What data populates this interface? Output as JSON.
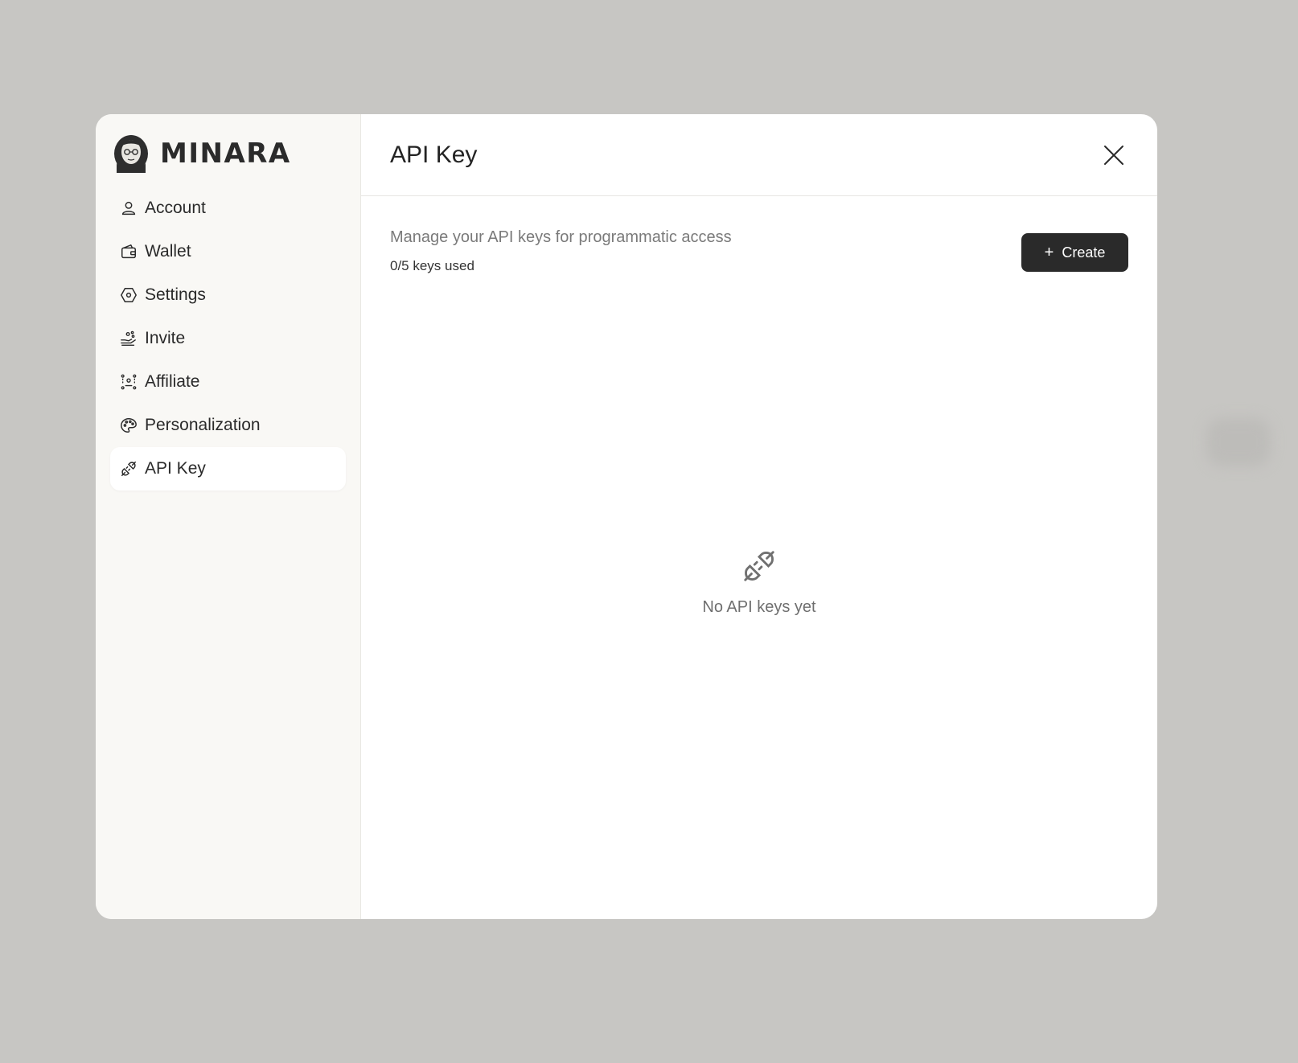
{
  "brand": {
    "name": "MINARA"
  },
  "sidebar": {
    "items": [
      {
        "label": "Account",
        "icon": "user-icon",
        "active": false
      },
      {
        "label": "Wallet",
        "icon": "wallet-icon",
        "active": false
      },
      {
        "label": "Settings",
        "icon": "settings-icon",
        "active": false
      },
      {
        "label": "Invite",
        "icon": "invite-icon",
        "active": false
      },
      {
        "label": "Affiliate",
        "icon": "affiliate-icon",
        "active": false
      },
      {
        "label": "Personalization",
        "icon": "palette-icon",
        "active": false
      },
      {
        "label": "API Key",
        "icon": "plug-icon",
        "active": true
      }
    ]
  },
  "main": {
    "title": "API Key",
    "description": "Manage your API keys for programmatic access",
    "usage": "0/5 keys used",
    "create_label": "Create",
    "empty_text": "No API keys yet"
  },
  "colors": {
    "backdrop": "#c7c6c3",
    "sidebar_bg": "#f9f8f5",
    "button_bg": "#2a2a2a",
    "text_primary": "#232323",
    "text_muted": "#7a7a7a"
  }
}
